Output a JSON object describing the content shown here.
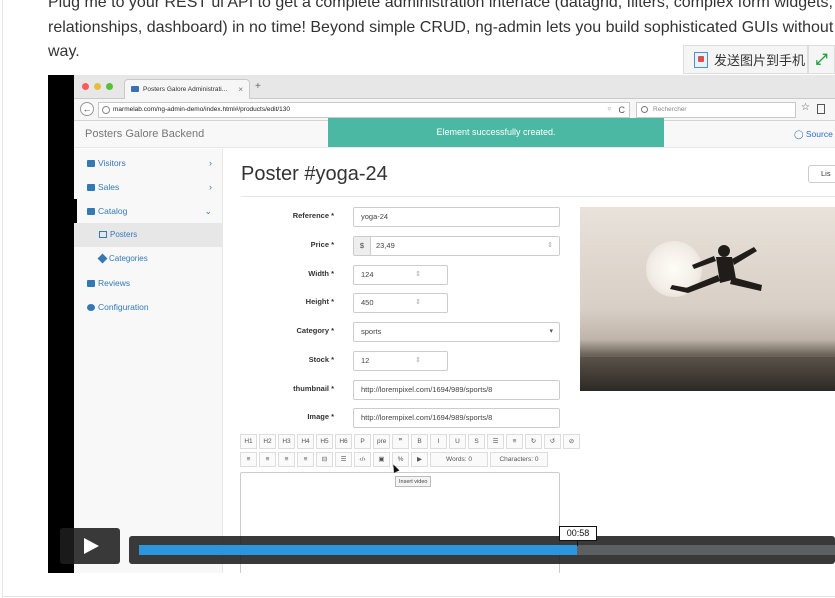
{
  "article": {
    "lines": [
      "Plug me to your REST ul API to get a complete administration interface (datagrid, filters, complex form widgets, m",
      "relationships, dashboard) in no time! Beyond simple CRUD, ng-admin lets you build sophisticated GUIs without ge",
      "way."
    ]
  },
  "overlay": {
    "send_to_phone": "发送图片到手机",
    "expand_icon": "expand-icon"
  },
  "browser": {
    "tab_title": "Posters Galore Administrati...",
    "tab_close": "×",
    "new_tab": "+",
    "url": "marmelab.com/ng-admin-demo/index.html#/products/edit/130",
    "search_placeholder": "Rechercher",
    "traffic_colors": [
      "#fc5b57",
      "#e5bf3c",
      "#57c038"
    ]
  },
  "app": {
    "brand": "Posters Galore Backend",
    "alert": "Element successfully created.",
    "source_link": "Source",
    "nav": [
      {
        "label": "Visitors",
        "chevron": "›"
      },
      {
        "label": "Sales",
        "chevron": "›"
      },
      {
        "label": "Catalog",
        "chevron": "⌄"
      }
    ],
    "nav_sub": [
      "Posters",
      "Categories"
    ],
    "nav_more": [
      "Reviews",
      "Configuration"
    ],
    "title": "Poster #yoga-24",
    "list_button": "Lis",
    "form": {
      "reference": {
        "label": "Reference *",
        "value": "yoga-24"
      },
      "price": {
        "label": "Price *",
        "currency": "$",
        "value": "23,49"
      },
      "width": {
        "label": "Width *",
        "value": "124"
      },
      "height": {
        "label": "Height *",
        "value": "450"
      },
      "category": {
        "label": "Category *",
        "value": "sports"
      },
      "stock": {
        "label": "Stock *",
        "value": "12"
      },
      "thumbnail": {
        "label": "thumbnail *",
        "value": "http://lorempixel.com/1694/989/sports/8"
      },
      "image": {
        "label": "Image *",
        "value": "http://lorempixel.com/1694/989/sports/8"
      }
    },
    "toolbar_row1": [
      "H1",
      "H2",
      "H3",
      "H4",
      "H5",
      "H6",
      "P",
      "pre",
      "❞",
      "B",
      "I",
      "U",
      "S",
      "☰",
      "≡",
      "↻",
      "↺",
      "⊘"
    ],
    "toolbar_row2": [
      "≡",
      "≡",
      "≡",
      "≡",
      "⊟",
      "☰",
      "‹/›",
      "▣",
      "%",
      "▶"
    ],
    "words": "Words: 0",
    "characters": "Characters: 0",
    "tooltip": "Insert video"
  },
  "player": {
    "time": "00:58",
    "progress": 0.63
  }
}
